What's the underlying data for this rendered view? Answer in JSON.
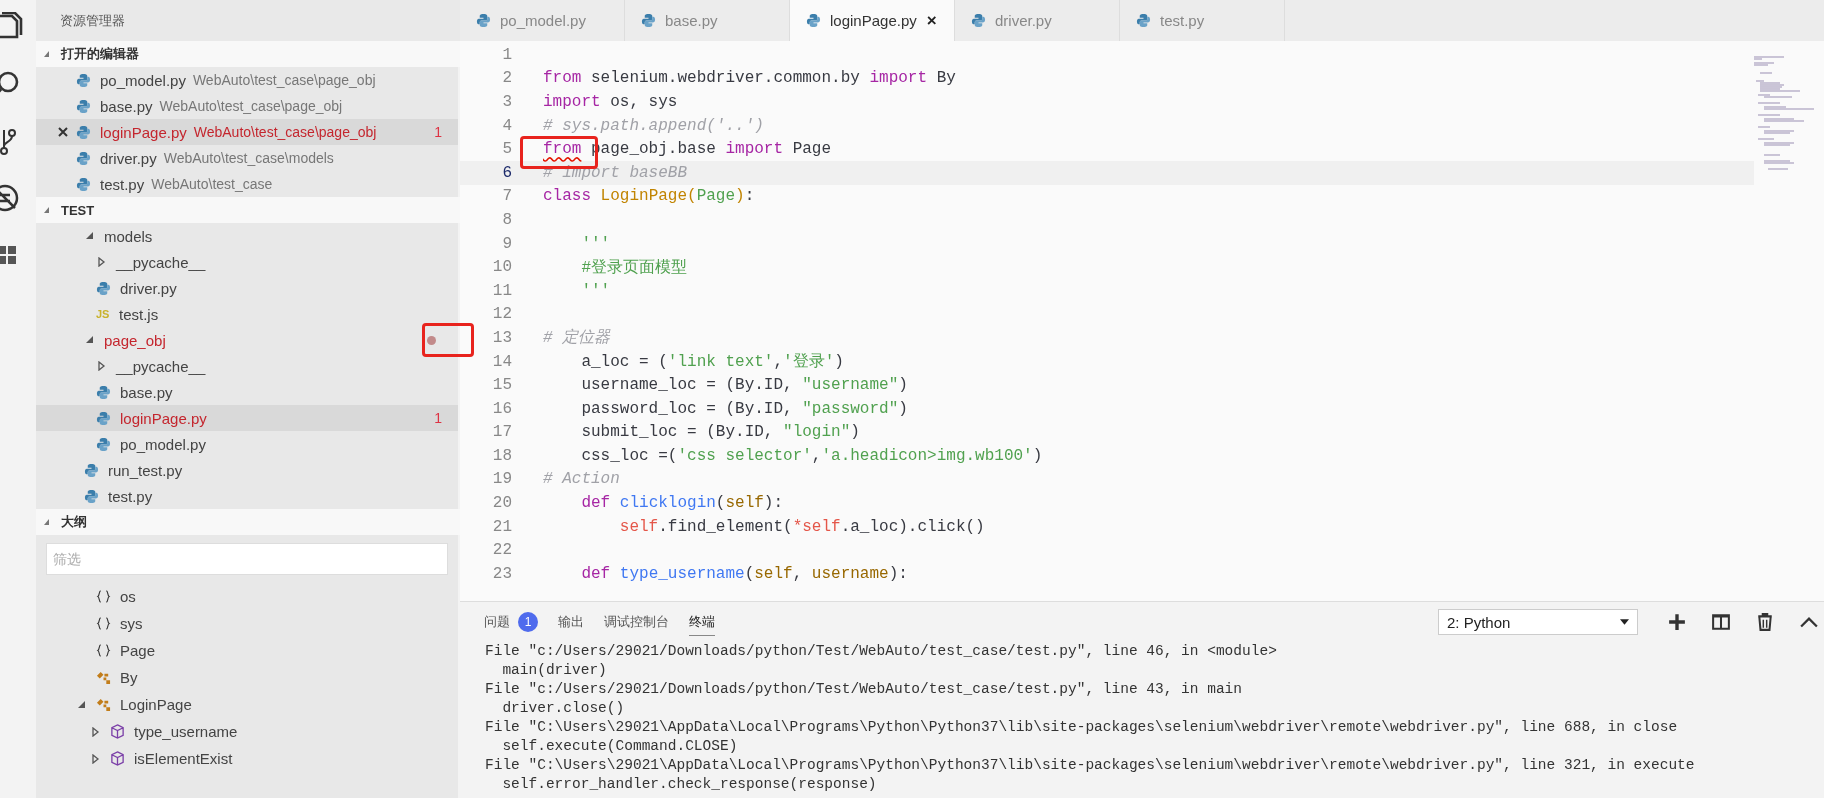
{
  "sidebar": {
    "title": "资源管理器",
    "open_editors": {
      "title": "打开的编辑器",
      "expanded": true,
      "items": [
        {
          "name": "po_model.py",
          "path": "WebAuto\\test_case\\page_obj",
          "selected": false,
          "error": false
        },
        {
          "name": "base.py",
          "path": "WebAuto\\test_case\\page_obj",
          "selected": false,
          "error": false
        },
        {
          "name": "loginPage.py",
          "path": "WebAuto\\test_case\\page_obj",
          "selected": true,
          "error": true,
          "problems": "1"
        },
        {
          "name": "driver.py",
          "path": "WebAuto\\test_case\\models",
          "selected": false,
          "error": false
        },
        {
          "name": "test.py",
          "path": "WebAuto\\test_case",
          "selected": false,
          "error": false
        }
      ]
    },
    "explorer": {
      "title": "TEST",
      "expanded": true,
      "tree": [
        {
          "label": "models",
          "kind": "folder",
          "expanded": true,
          "selected": false,
          "error": false,
          "children": [
            {
              "label": "__pycache__",
              "kind": "folder",
              "expanded": false,
              "selected": false,
              "error": false
            },
            {
              "label": "driver.py",
              "kind": "python",
              "selected": false,
              "error": false
            },
            {
              "label": "test.js",
              "kind": "js",
              "icon_label": "JS",
              "selected": false,
              "error": false
            }
          ]
        },
        {
          "label": "page_obj",
          "kind": "folder",
          "expanded": true,
          "selected": false,
          "error": true,
          "dot": true,
          "children": [
            {
              "label": "__pycache__",
              "kind": "folder",
              "expanded": false,
              "selected": false,
              "error": false
            },
            {
              "label": "base.py",
              "kind": "python",
              "selected": false,
              "error": false
            },
            {
              "label": "loginPage.py",
              "kind": "python",
              "selected": true,
              "error": true,
              "problems": "1"
            },
            {
              "label": "po_model.py",
              "kind": "python",
              "selected": false,
              "error": false
            }
          ]
        },
        {
          "label": "run_test.py",
          "kind": "python",
          "selected": false,
          "error": false
        },
        {
          "label": "test.py",
          "kind": "python",
          "selected": false,
          "error": false
        }
      ]
    },
    "outline": {
      "title": "大纲",
      "expanded": true,
      "filter": {
        "placeholder": "筛选"
      },
      "items": [
        {
          "label": "os",
          "kind": "module"
        },
        {
          "label": "sys",
          "kind": "module"
        },
        {
          "label": "Page",
          "kind": "module"
        },
        {
          "label": "By",
          "kind": "class"
        },
        {
          "label": "LoginPage",
          "kind": "class",
          "expanded": true,
          "children": [
            {
              "label": "type_username",
              "kind": "method",
              "expanded": false
            },
            {
              "label": "isElementExist",
              "kind": "method",
              "expanded": false
            }
          ]
        }
      ]
    }
  },
  "tabs": [
    {
      "label": "po_model.py",
      "selected": false
    },
    {
      "label": "base.py",
      "selected": false
    },
    {
      "label": "loginPage.py",
      "selected": true,
      "close": "×"
    },
    {
      "label": "driver.py",
      "selected": false
    },
    {
      "label": "test.py",
      "selected": false
    }
  ],
  "editor": {
    "lines": [
      {
        "n": "1"
      },
      {
        "n": "2",
        "tokens": [
          {
            "kind": "kw",
            "text": "from"
          },
          {
            "kind": "p",
            "text": " selenium.webdriver.common.by "
          },
          {
            "kind": "kw",
            "text": "import"
          },
          {
            "kind": "p",
            "text": " By"
          }
        ]
      },
      {
        "n": "3",
        "tokens": [
          {
            "kind": "kw",
            "text": "import"
          },
          {
            "kind": "p",
            "text": " os, sys"
          }
        ]
      },
      {
        "n": "4",
        "tokens": [
          {
            "kind": "cmt",
            "text": "# sys.path.append('..')"
          }
        ]
      },
      {
        "n": "5",
        "tokens": [
          {
            "kind": "kw",
            "text": "from",
            "error": true
          },
          {
            "kind": "p",
            "text": " page_obj.base "
          },
          {
            "kind": "kw",
            "text": "import"
          },
          {
            "kind": "p",
            "text": " Page"
          }
        ]
      },
      {
        "n": "6",
        "current": true,
        "tokens": [
          {
            "kind": "cmt",
            "text": "# import baseBB"
          }
        ]
      },
      {
        "n": "7",
        "tokens": [
          {
            "kind": "kw",
            "text": "class"
          },
          {
            "kind": "cls",
            "text": " LoginPage("
          },
          {
            "kind": "str",
            "text": "Page"
          },
          {
            "kind": "cls",
            "text": ")"
          },
          {
            "kind": "p",
            "text": ":"
          }
        ]
      },
      {
        "n": "8"
      },
      {
        "n": "9",
        "tokens": [
          {
            "kind": "str",
            "text": "    '''"
          }
        ]
      },
      {
        "n": "10",
        "tokens": [
          {
            "kind": "str",
            "text": "    #登录页面模型"
          }
        ]
      },
      {
        "n": "11",
        "tokens": [
          {
            "kind": "str",
            "text": "    '''"
          }
        ]
      },
      {
        "n": "12"
      },
      {
        "n": "13",
        "tokens": [
          {
            "kind": "cmt",
            "text": "# 定位器"
          }
        ]
      },
      {
        "n": "14",
        "tokens": [
          {
            "kind": "p",
            "text": "    a_loc = ("
          },
          {
            "kind": "str",
            "text": "'link text'"
          },
          {
            "kind": "p",
            "text": ","
          },
          {
            "kind": "str",
            "text": "'登录'"
          },
          {
            "kind": "p",
            "text": ")"
          }
        ]
      },
      {
        "n": "15",
        "tokens": [
          {
            "kind": "p",
            "text": "    username_loc = (By.ID, "
          },
          {
            "kind": "str",
            "text": "\"username\""
          },
          {
            "kind": "p",
            "text": ")"
          }
        ]
      },
      {
        "n": "16",
        "tokens": [
          {
            "kind": "p",
            "text": "    password_loc = (By.ID, "
          },
          {
            "kind": "str",
            "text": "\"password\""
          },
          {
            "kind": "p",
            "text": ")"
          }
        ]
      },
      {
        "n": "17",
        "tokens": [
          {
            "kind": "p",
            "text": "    submit_loc = (By.ID, "
          },
          {
            "kind": "str",
            "text": "\"login\""
          },
          {
            "kind": "p",
            "text": ")"
          }
        ]
      },
      {
        "n": "18",
        "tokens": [
          {
            "kind": "p",
            "text": "    css_loc =("
          },
          {
            "kind": "str",
            "text": "'css selector'"
          },
          {
            "kind": "p",
            "text": ","
          },
          {
            "kind": "str",
            "text": "'a.headicon>img.wb100'"
          },
          {
            "kind": "p",
            "text": ")"
          }
        ]
      },
      {
        "n": "19",
        "tokens": [
          {
            "kind": "cmt",
            "text": "# Action"
          }
        ]
      },
      {
        "n": "20",
        "tokens": [
          {
            "kind": "kw",
            "text": "    def"
          },
          {
            "kind": "fn",
            "text": " clicklogin"
          },
          {
            "kind": "p",
            "text": "("
          },
          {
            "kind": "param",
            "text": "self"
          },
          {
            "kind": "p",
            "text": "):"
          }
        ]
      },
      {
        "n": "21",
        "tokens": [
          {
            "kind": "self",
            "text": "        self"
          },
          {
            "kind": "p",
            "text": ".find_element("
          },
          {
            "kind": "self",
            "text": "*self"
          },
          {
            "kind": "p",
            "text": ".a_loc).click()"
          }
        ]
      },
      {
        "n": "22"
      },
      {
        "n": "23",
        "tokens": [
          {
            "kind": "kw",
            "text": "    def"
          },
          {
            "kind": "fn",
            "text": " type_username"
          },
          {
            "kind": "p",
            "text": "("
          },
          {
            "kind": "param",
            "text": "self"
          },
          {
            "kind": "p",
            "text": ", "
          },
          {
            "kind": "param",
            "text": "username"
          },
          {
            "kind": "p",
            "text": "):"
          }
        ]
      }
    ]
  },
  "panel": {
    "tabs": [
      {
        "label": "问题",
        "selected": false,
        "badge": "1"
      },
      {
        "label": "输出",
        "selected": false
      },
      {
        "label": "调试控制台",
        "selected": false
      },
      {
        "label": "终端",
        "selected": true
      }
    ],
    "terminal_select": {
      "value": "2: Python"
    },
    "terminal_lines": [
      "File \"c:/Users/29021/Downloads/python/Test/WebAuto/test_case/test.py\", line 46, in <module>",
      "  main(driver)",
      "File \"c:/Users/29021/Downloads/python/Test/WebAuto/test_case/test.py\", line 43, in main",
      "  driver.close()",
      "File \"C:\\Users\\29021\\AppData\\Local\\Programs\\Python\\Python37\\lib\\site-packages\\selenium\\webdriver\\remote\\webdriver.py\", line 688, in close",
      "  self.execute(Command.CLOSE)",
      "File \"C:\\Users\\29021\\AppData\\Local\\Programs\\Python\\Python37\\lib\\site-packages\\selenium\\webdriver\\remote\\webdriver.py\", line 321, in execute",
      "  self.error_handler.check_response(response)"
    ]
  }
}
